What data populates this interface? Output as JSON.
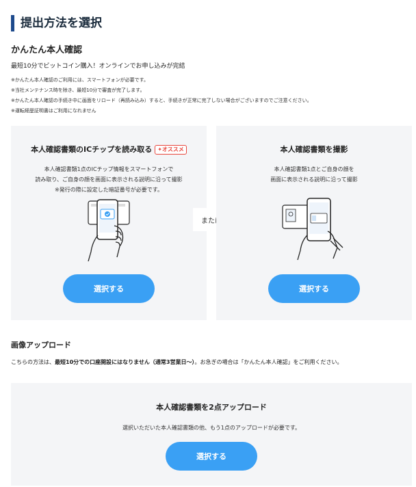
{
  "page": {
    "heading": "提出方法を選択"
  },
  "easy_verify": {
    "title": "かんたん本人確認",
    "lead": "最短10分でビットコイン購入！オンラインでお申し込みが完結",
    "notes": [
      "※かんたん本人確認のご利用には、スマートフォンが必要です。",
      "※当社メンテナンス時を除き、最短10分で審査が完了します。",
      "※かんたん本人確認の手続き中に画面をリロード（再読み込み）すると、手続きが正常に完了しない場合がございますのでご注意ください。",
      "※運転経歴証明書はご利用になれません"
    ]
  },
  "ic_card": {
    "title": "本人確認書類のICチップを読み取る",
    "badge": "オススメ",
    "desc": [
      "本人確認書類1点のICチップ情報をスマートフォンで",
      "読み取り、ご自身の顔を画面に表示される説明に沿って撮影",
      "※発行の際に設定した暗証番号が必要です。"
    ],
    "button": "選択する"
  },
  "or_label": "または",
  "photo_card": {
    "title": "本人確認書類を撮影",
    "desc": [
      "本人確認書類1点とご自身の顔を",
      "画面に表示される説明に沿って撮影"
    ],
    "button": "選択する"
  },
  "image_upload": {
    "title": "画像アップロード",
    "text_before": "こちらの方法は、",
    "text_bold": "最短10分での口座開設にはなりません（通常3営業日〜）",
    "text_after": "。お急ぎの場合は「かんたん本人確認」をご利用ください。",
    "card": {
      "title": "本人確認書類を2点アップロード",
      "desc": "選択いただいた本人確認書類の他、もう1点のアップロードが必要です。",
      "button": "選択する"
    }
  },
  "colors": {
    "accent": "#3aa0f4",
    "heading_bar": "#1d4a8c",
    "badge": "#e8453c",
    "card_bg": "#f4f5f7"
  }
}
